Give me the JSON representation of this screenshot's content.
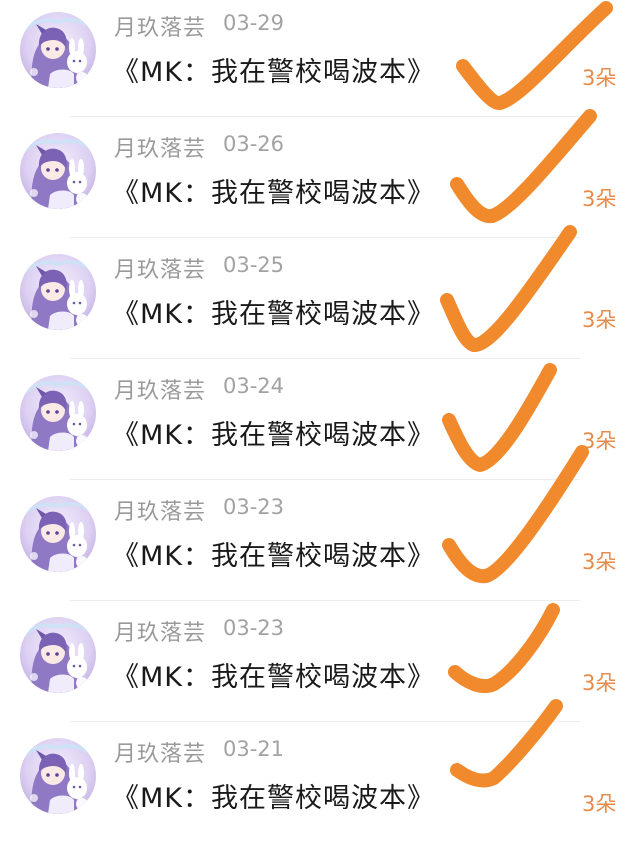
{
  "items": [
    {
      "user": "月玖落芸",
      "date": "03-29",
      "title": "《MK：我在警校喝波本》",
      "count": "3朵"
    },
    {
      "user": "月玖落芸",
      "date": "03-26",
      "title": "《MK：我在警校喝波本》",
      "count": "3朵"
    },
    {
      "user": "月玖落芸",
      "date": "03-25",
      "title": "《MK：我在警校喝波本》",
      "count": "3朵"
    },
    {
      "user": "月玖落芸",
      "date": "03-24",
      "title": "《MK：我在警校喝波本》",
      "count": "3朵"
    },
    {
      "user": "月玖落芸",
      "date": "03-23",
      "title": "《MK：我在警校喝波本》",
      "count": "3朵"
    },
    {
      "user": "月玖落芸",
      "date": "03-23",
      "title": "《MK：我在警校喝波本》",
      "count": "3朵"
    },
    {
      "user": "月玖落芸",
      "date": "03-21",
      "title": "《MK：我在警校喝波本》",
      "count": "3朵"
    }
  ],
  "colors": {
    "checkmark": "#f08a2c",
    "count": "#e88a4a",
    "username": "#9a9a9a",
    "title": "#1a1a1a",
    "avatar_bg": "#d9ccef"
  },
  "annotation_icon": "orange-checkmark-icon"
}
